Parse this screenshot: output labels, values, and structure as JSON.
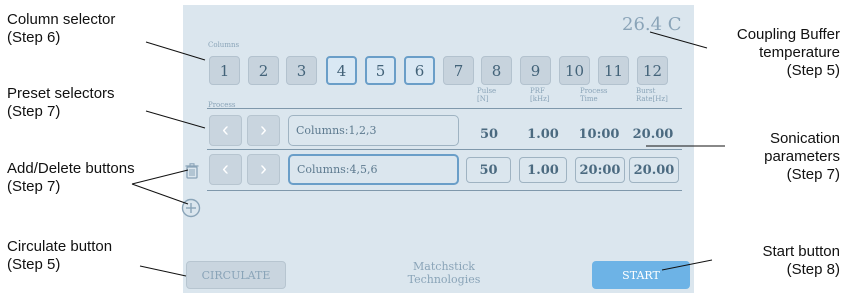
{
  "screen": {
    "temperature": "26.4 C",
    "columns_label": "Columns",
    "columns": [
      "1",
      "2",
      "3",
      "4",
      "5",
      "6",
      "7",
      "8",
      "9",
      "10",
      "11",
      "12"
    ],
    "selected_columns": [
      "4",
      "5",
      "6"
    ],
    "headers": {
      "process": "Process",
      "pulse": [
        "Pulse",
        "[N]"
      ],
      "prf": [
        "PRF",
        "[kHz]"
      ],
      "process_time": [
        "Process",
        "Time"
      ],
      "burst_rate": [
        "Burst",
        "Rate[Hz]"
      ]
    },
    "rows": [
      {
        "preset": "Columns:1,2,3",
        "pulse": "50",
        "prf": "1.00",
        "time": "10:00",
        "burst": "20.00",
        "selected": false
      },
      {
        "preset": "Columns:4,5,6",
        "pulse": "50",
        "prf": "1.00",
        "time": "20:00",
        "burst": "20.00",
        "selected": true
      }
    ],
    "circulate_label": "CIRCULATE",
    "start_label": "START",
    "company": [
      "Matchstick",
      "Technologies"
    ],
    "icons": {
      "prev": "chevron-left-icon",
      "next": "chevron-right-icon",
      "delete": "trash-icon",
      "add": "plus-circle-icon"
    }
  },
  "annotations": {
    "column_selector": [
      "Column selector",
      "(Step 6)"
    ],
    "preset_selectors": [
      "Preset selectors",
      "(Step 7)"
    ],
    "add_delete": [
      "Add/Delete buttons",
      "(Step 7)"
    ],
    "circulate": [
      "Circulate button",
      "(Step 5)"
    ],
    "coupling": [
      "Coupling Buffer",
      "temperature",
      "(Step 5)"
    ],
    "sonication": [
      "Sonication",
      "parameters",
      "(Step 7)"
    ],
    "start": [
      "Start button",
      "(Step 8)"
    ]
  }
}
